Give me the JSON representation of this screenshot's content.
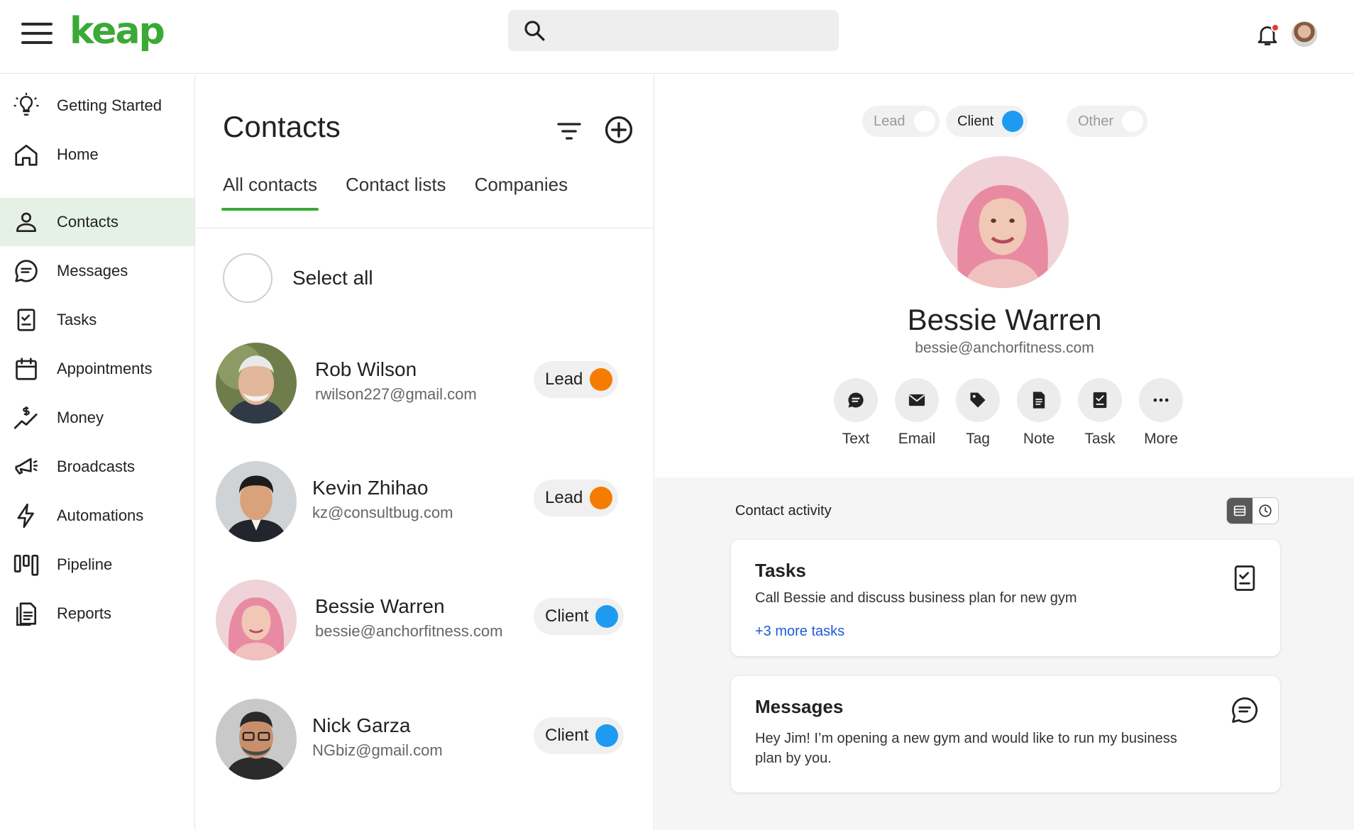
{
  "header": {
    "logo_text": "keap",
    "search": {
      "placeholder": "",
      "value": ""
    },
    "notification": {
      "has_unread": true
    }
  },
  "sidebar": {
    "items": [
      {
        "label": "Getting Started",
        "icon": "lightbulb-icon",
        "active": false
      },
      {
        "label": "Home",
        "icon": "home-icon",
        "active": false
      },
      {
        "label": "Contacts",
        "icon": "person-icon",
        "active": true
      },
      {
        "label": "Messages",
        "icon": "chat-bubble-icon",
        "active": false
      },
      {
        "label": "Tasks",
        "icon": "checklist-icon",
        "active": false
      },
      {
        "label": "Appointments",
        "icon": "calendar-icon",
        "active": false
      },
      {
        "label": "Money",
        "icon": "money-chart-icon",
        "active": false
      },
      {
        "label": "Broadcasts",
        "icon": "megaphone-icon",
        "active": false
      },
      {
        "label": "Automations",
        "icon": "lightning-icon",
        "active": false
      },
      {
        "label": "Pipeline",
        "icon": "pipeline-icon",
        "active": false
      },
      {
        "label": "Reports",
        "icon": "report-icon",
        "active": false
      }
    ]
  },
  "contacts": {
    "title": "Contacts",
    "tabs": [
      {
        "label": "All contacts",
        "active": true
      },
      {
        "label": "Contact lists",
        "active": false
      },
      {
        "label": "Companies",
        "active": false
      }
    ],
    "select_all_label": "Select all",
    "list": [
      {
        "name": "Rob Wilson",
        "email": "rwilson227@gmail.com",
        "status": "Lead",
        "status_color": "#f57c00"
      },
      {
        "name": "Kevin Zhihao",
        "email": "kz@consultbug.com",
        "status": "Lead",
        "status_color": "#f57c00"
      },
      {
        "name": "Bessie Warren",
        "email": "bessie@anchorfitness.com",
        "status": "Client",
        "status_color": "#1e9bf0"
      },
      {
        "name": "Nick Garza",
        "email": "NGbiz@gmail.com",
        "status": "Client",
        "status_color": "#1e9bf0"
      }
    ]
  },
  "detail": {
    "status_options": [
      {
        "label": "Lead",
        "selected": false
      },
      {
        "label": "Client",
        "selected": true
      },
      {
        "label": "Other",
        "selected": false
      }
    ],
    "name": "Bessie Warren",
    "email": "bessie@anchorfitness.com",
    "actions": [
      {
        "label": "Text",
        "icon": "text-bubble-icon"
      },
      {
        "label": "Email",
        "icon": "envelope-icon"
      },
      {
        "label": "Tag",
        "icon": "tag-icon"
      },
      {
        "label": "Note",
        "icon": "note-icon"
      },
      {
        "label": "Task",
        "icon": "task-icon"
      },
      {
        "label": "More",
        "icon": "more-dots-icon"
      }
    ],
    "activity": {
      "title": "Contact activity",
      "tasks_card": {
        "title": "Tasks",
        "text": "Call Bessie and discuss business plan for new gym",
        "link": "+3 more tasks"
      },
      "messages_card": {
        "title": "Messages",
        "text": "Hey Jim! I’m opening a new gym and would like to run my business plan by you."
      }
    }
  },
  "colors": {
    "brand_green": "#3aa935",
    "active_nav_bg": "#e6f1e5",
    "lead_orange": "#f57c00",
    "client_blue": "#1e9bf0",
    "link_blue": "#1e5bd8"
  }
}
